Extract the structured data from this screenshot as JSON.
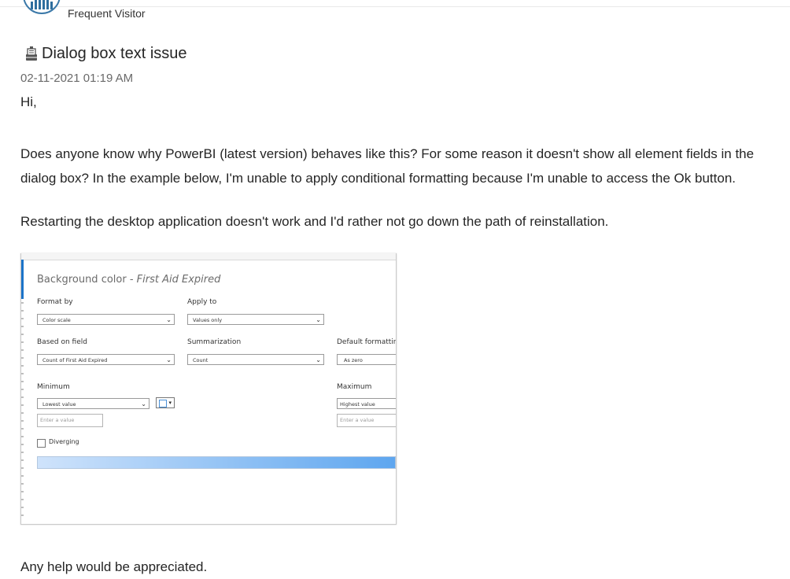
{
  "post": {
    "author_rank": "Frequent Visitor",
    "subject": "Dialog box text issue",
    "date": "02-11-2021 01:19 AM",
    "greeting": "Hi,",
    "paragraph1": "Does anyone know why PowerBI (latest version) behaves like this? For some reason it doesn't show all element fields in the dialog box? In the example below, I'm unable to apply conditional formatting because I'm unable to access the Ok button.",
    "paragraph2": "Restarting the desktop application doesn't work and I'd rather not go down the path of reinstallation.",
    "closing": "Any help would be appreciated."
  },
  "icons": {
    "avatar": "avatar-image",
    "subject": "message-subject-icon"
  },
  "dialog": {
    "title": "Background color - ",
    "title_field": "First Aid Expired",
    "format_by_label": "Format by",
    "format_by_value": "Color scale",
    "apply_to_label": "Apply to",
    "apply_to_value": "Values only",
    "based_on_label": "Based on field",
    "based_on_value": "Count of First Aid Expired",
    "summarization_label": "Summarization",
    "summarization_value": "Count",
    "default_formatting_label": "Default formattir",
    "default_formatting_value": "As zero",
    "minimum_label": "Minimum",
    "minimum_value": "Lowest value",
    "minimum_placeholder": "Enter a value",
    "maximum_label": "Maximum",
    "maximum_value": "Highest value",
    "maximum_placeholder": "Enter a value",
    "diverging_label": "Diverging",
    "caret": "⌄",
    "color_dropdown": "▾"
  },
  "colors": {
    "accent": "#1c74c9",
    "gradient_start": "#cfe3fb",
    "gradient_end": "#5ea6ef"
  }
}
